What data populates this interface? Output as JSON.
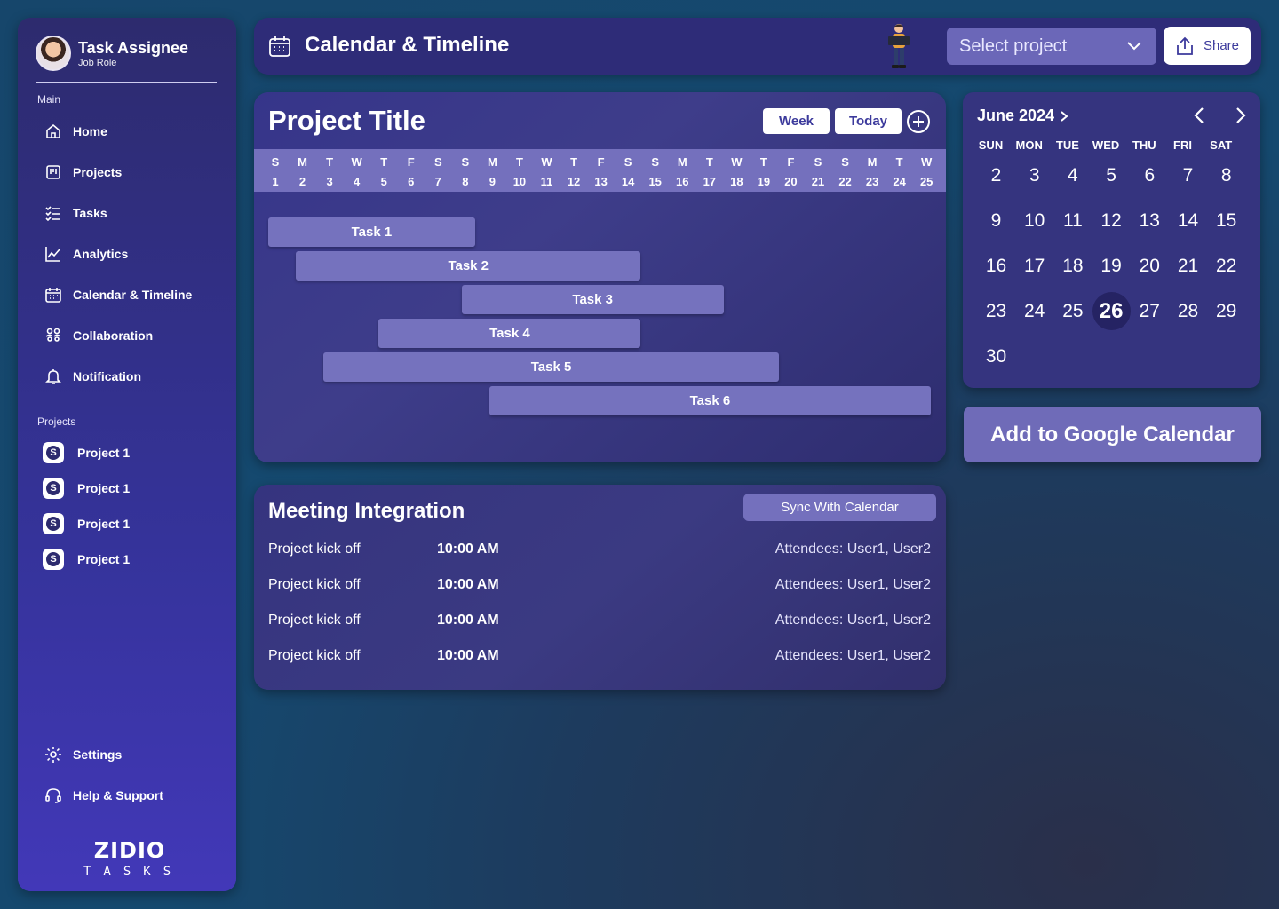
{
  "profile": {
    "name": "Task Assignee",
    "role": "Job Role"
  },
  "sidebar": {
    "main_label": "Main",
    "items": [
      {
        "label": "Home",
        "icon": "home-icon"
      },
      {
        "label": "Projects",
        "icon": "projects-icon"
      },
      {
        "label": "Tasks",
        "icon": "tasks-icon"
      },
      {
        "label": "Analytics",
        "icon": "analytics-icon"
      },
      {
        "label": "Calendar & Timeline",
        "icon": "calendar-icon"
      },
      {
        "label": "Collaboration",
        "icon": "collaboration-icon"
      },
      {
        "label": "Notification",
        "icon": "bell-icon"
      }
    ],
    "projects_label": "Projects",
    "projects": [
      {
        "label": "Project 1"
      },
      {
        "label": "Project 1"
      },
      {
        "label": "Project 1"
      },
      {
        "label": "Project 1"
      }
    ],
    "bottom": [
      {
        "label": "Settings",
        "icon": "gear-icon"
      },
      {
        "label": "Help & Support",
        "icon": "headset-icon"
      }
    ],
    "logo": {
      "main": "ZIDIO",
      "sub": "TASKS"
    }
  },
  "header": {
    "title": "Calendar & Timeline",
    "select_placeholder": "Select project",
    "share_label": "Share"
  },
  "gantt": {
    "title": "Project Title",
    "week_label": "Week",
    "today_label": "Today",
    "days": [
      {
        "l": "S",
        "n": "1"
      },
      {
        "l": "M",
        "n": "2"
      },
      {
        "l": "T",
        "n": "3"
      },
      {
        "l": "W",
        "n": "4"
      },
      {
        "l": "T",
        "n": "5"
      },
      {
        "l": "F",
        "n": "6"
      },
      {
        "l": "S",
        "n": "7"
      },
      {
        "l": "S",
        "n": "8"
      },
      {
        "l": "M",
        "n": "9"
      },
      {
        "l": "T",
        "n": "10"
      },
      {
        "l": "W",
        "n": "11"
      },
      {
        "l": "T",
        "n": "12"
      },
      {
        "l": "F",
        "n": "13"
      },
      {
        "l": "S",
        "n": "14"
      },
      {
        "l": "S",
        "n": "15"
      },
      {
        "l": "M",
        "n": "16"
      },
      {
        "l": "T",
        "n": "17"
      },
      {
        "l": "W",
        "n": "18"
      },
      {
        "l": "T",
        "n": "19"
      },
      {
        "l": "F",
        "n": "20"
      },
      {
        "l": "S",
        "n": "21"
      },
      {
        "l": "S",
        "n": "22"
      },
      {
        "l": "M",
        "n": "23"
      },
      {
        "l": "T",
        "n": "24"
      },
      {
        "l": "W",
        "n": "25"
      }
    ],
    "tasks": [
      {
        "label": "Task 1",
        "start": 1,
        "end": 8
      },
      {
        "label": "Task 2",
        "start": 2,
        "end": 14
      },
      {
        "label": "Task 3",
        "start": 8,
        "end": 17
      },
      {
        "label": "Task 4",
        "start": 5,
        "end": 14
      },
      {
        "label": "Task 5",
        "start": 3,
        "end": 19
      },
      {
        "label": "Task 6",
        "start": 9,
        "end": 25
      }
    ]
  },
  "meeting": {
    "title": "Meeting Integration",
    "sync_label": "Sync With Calendar",
    "rows": [
      {
        "name": "Project kick off",
        "time": "10:00 AM",
        "attendees": "Attendees: User1, User2"
      },
      {
        "name": "Project kick off",
        "time": "10:00 AM",
        "attendees": "Attendees: User1, User2"
      },
      {
        "name": "Project kick off",
        "time": "10:00 AM",
        "attendees": "Attendees: User1, User2"
      },
      {
        "name": "Project kick off",
        "time": "10:00 AM",
        "attendees": "Attendees: User1, User2"
      }
    ]
  },
  "mini_calendar": {
    "month_label": "June 2024",
    "weekdays": [
      "SUN",
      "MON",
      "TUE",
      "WED",
      "THU",
      "FRI",
      "SAT"
    ],
    "first_weekday_index": 1,
    "first_day": 2,
    "last_day": 30,
    "selected": 26
  },
  "google_button": {
    "label": "Add to Google Calendar"
  },
  "colors": {
    "accent": "#7470bd",
    "panel": "#35347f",
    "sidebar_top": "#2d2b6e",
    "sidebar_bottom": "#4238b8",
    "button_text": "#3c3a9c"
  }
}
